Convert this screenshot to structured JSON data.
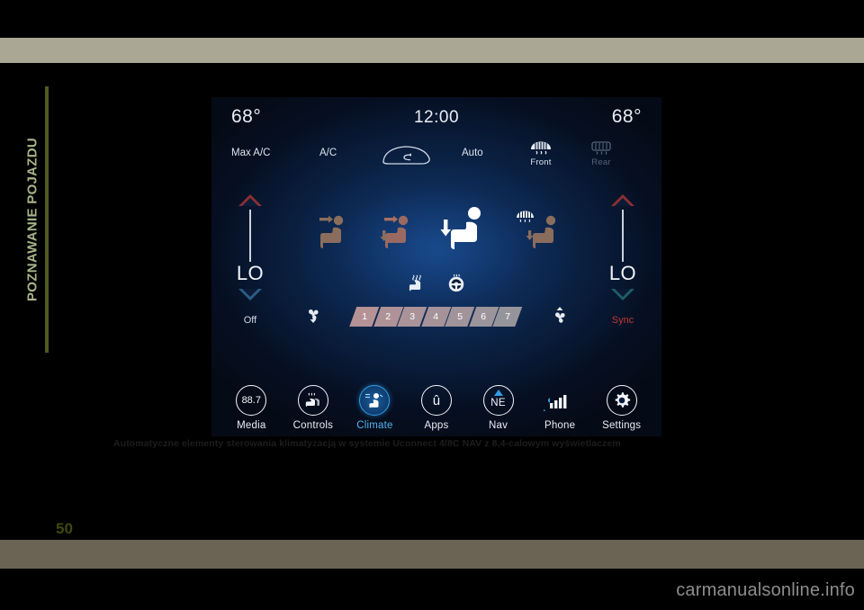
{
  "document": {
    "chapter_tab": "POZNAWANIE POJAZDU",
    "page_number": "50",
    "caption": "Automatyczne elementy sterowania klimatyzacją w systemie Uconnect 4/8C NAV z 8,4-calowym wyświetlaczem",
    "watermark": "carmanualsonline.info",
    "colors": {
      "band_top": "#aba795",
      "band_bottom": "#6b6354",
      "chapter_text": "#a9b48a",
      "chapter_rule": "#4f5a21",
      "page_number": "#3f4a10"
    }
  },
  "head_unit": {
    "status": {
      "temp_left": "68°",
      "clock": "12:00",
      "temp_right": "68°"
    },
    "modes": [
      {
        "label": "Max A/C",
        "name": "max-ac",
        "state": "on"
      },
      {
        "label": "A/C",
        "name": "ac",
        "state": "on"
      },
      {
        "label": "",
        "name": "recirculation",
        "state": "on"
      },
      {
        "label": "Auto",
        "name": "auto",
        "state": "on"
      },
      {
        "label": "Front",
        "name": "front-defrost",
        "state": "on"
      },
      {
        "label": "Rear",
        "name": "rear-defrost",
        "state": "dimmed"
      }
    ],
    "temperature_left": {
      "up_label": "increase-temperature",
      "value": "LO",
      "down_label": "decrease-temperature",
      "footer": "Off"
    },
    "temperature_right": {
      "up_label": "increase-temperature",
      "value": "LO",
      "down_label": "decrease-temperature",
      "footer": "Sync"
    },
    "airflow_modes": [
      {
        "name": "airflow-face",
        "selected": false
      },
      {
        "name": "airflow-face-and-feet",
        "selected": false
      },
      {
        "name": "airflow-feet",
        "selected": true
      },
      {
        "name": "airflow-defrost-and-feet",
        "selected": false
      }
    ],
    "comfort": [
      {
        "name": "heated-seat-icon"
      },
      {
        "name": "heated-steering-wheel-icon"
      }
    ],
    "fan": {
      "decrease_icon": "fan-decrease-icon",
      "increase_icon": "fan-increase-icon",
      "segments": [
        "1",
        "2",
        "3",
        "4",
        "5",
        "6",
        "7"
      ],
      "level": 4,
      "colors": {
        "active": "#b49296",
        "inactive": "#8d9095"
      }
    },
    "navbar": [
      {
        "label": "Media",
        "icon": "88.7",
        "name": "media",
        "active": false
      },
      {
        "label": "Controls",
        "icon": "controls",
        "name": "controls",
        "active": false
      },
      {
        "label": "Climate",
        "icon": "climate",
        "name": "climate",
        "active": true
      },
      {
        "label": "Apps",
        "icon": "û",
        "name": "apps",
        "active": false
      },
      {
        "label": "Nav",
        "icon": "NE",
        "name": "nav",
        "active": false
      },
      {
        "label": "Phone",
        "icon": "signal",
        "name": "phone",
        "active": false
      },
      {
        "label": "Settings",
        "icon": "gear",
        "name": "settings",
        "active": false
      }
    ]
  }
}
